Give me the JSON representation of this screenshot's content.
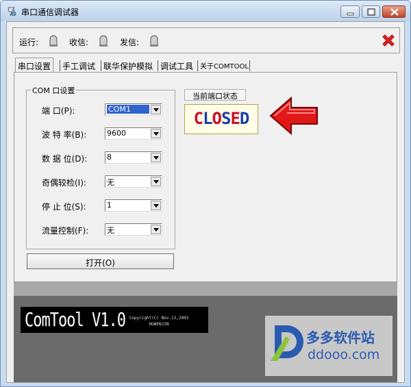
{
  "window": {
    "title": "串口通信调试器",
    "icon": "serial-port-icon"
  },
  "status_bar": {
    "run_label": "运行:",
    "receive_label": "收信:",
    "send_label": "发信:",
    "led_icon": "indicator-led-icon",
    "close_icon": "red-x-icon"
  },
  "tabs": [
    {
      "label": "串口设置",
      "active": true
    },
    {
      "label": "手工调试",
      "active": false
    },
    {
      "label": "联华保护模拟",
      "active": false
    },
    {
      "label": "调试工具",
      "active": false
    },
    {
      "label": "关于COMTOOL",
      "active": false
    }
  ],
  "com_settings": {
    "group_title": "COM 口设置",
    "fields": [
      {
        "label": "端    口(P):",
        "value": "COM1"
      },
      {
        "label": "波 特 率(B):",
        "value": "9600"
      },
      {
        "label": "数 据 位(D):",
        "value": "8"
      },
      {
        "label": "奇偶较检(I):",
        "value": "无"
      },
      {
        "label": "停 止 位(S):",
        "value": "1"
      },
      {
        "label": "流量控制(F):",
        "value": "无"
      }
    ],
    "open_button": "打开(O)"
  },
  "port_status": {
    "label": "当前端口状态",
    "state": "CLOSED",
    "state_colors": [
      "#c8102e",
      "#1a3fa8",
      "#c8102e",
      "#1a3fa8",
      "#c8102e",
      "#1a3fa8"
    ]
  },
  "banner": {
    "title": "ComTool V1.0",
    "copyright": "Copyright(C) Nov.13,2003",
    "author": "HUWENJIN"
  },
  "watermark": {
    "name_cn": "多多软件站",
    "domain": "ddooo.com"
  },
  "colors": {
    "accent": "#3163ce",
    "arrow": "#e01818"
  }
}
